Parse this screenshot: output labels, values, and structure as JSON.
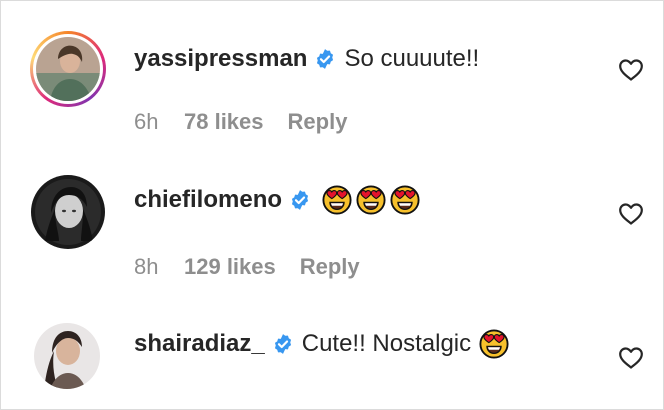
{
  "colors": {
    "text": "#262626",
    "secondary": "#8e8e8e",
    "verified": "#3897f0",
    "story_ring": [
      "#f58529",
      "#dd2a7b",
      "#8134af"
    ]
  },
  "comments": [
    {
      "username": "yassipressman",
      "verified": true,
      "text": "So cuuuute!!",
      "emojis": [],
      "age": "6h",
      "likes": "78 likes",
      "reply": "Reply",
      "has_story_ring": true,
      "avatar_icon": "user-avatar"
    },
    {
      "username": "chiefilomeno",
      "verified": true,
      "text": "",
      "emojis": [
        "heart-eyes-emoji",
        "heart-eyes-emoji",
        "heart-eyes-emoji"
      ],
      "age": "8h",
      "likes": "129 likes",
      "reply": "Reply",
      "has_story_ring": false,
      "avatar_icon": "user-avatar"
    },
    {
      "username": "shairadiaz_",
      "verified": true,
      "text": "Cute!! Nostalgic",
      "emojis": [
        "heart-eyes-emoji"
      ],
      "age": "",
      "likes": "",
      "reply": "",
      "has_story_ring": false,
      "avatar_icon": "user-avatar"
    }
  ]
}
